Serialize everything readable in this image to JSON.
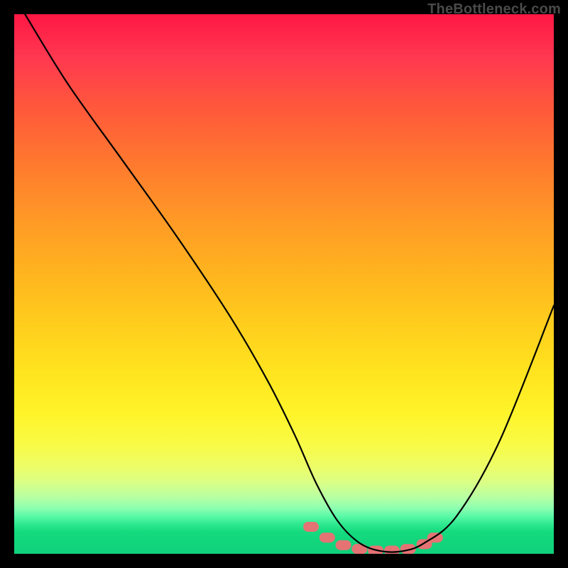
{
  "watermark": {
    "text": "TheBottleneck.com"
  },
  "chart_data": {
    "type": "line",
    "title": "",
    "xlabel": "",
    "ylabel": "",
    "xlim": [
      0,
      100
    ],
    "ylim": [
      0,
      100
    ],
    "grid": false,
    "legend": false,
    "background_gradient_stops": [
      {
        "pct": 0,
        "color": "#ff1744"
      },
      {
        "pct": 18,
        "color": "#ff5a3a"
      },
      {
        "pct": 38,
        "color": "#ff9926"
      },
      {
        "pct": 58,
        "color": "#ffcf1d"
      },
      {
        "pct": 74,
        "color": "#fff42a"
      },
      {
        "pct": 87,
        "color": "#d8ff88"
      },
      {
        "pct": 93,
        "color": "#5cf9a8"
      },
      {
        "pct": 100,
        "color": "#10d07b"
      }
    ],
    "series": [
      {
        "name": "bottleneck-curve",
        "color": "#000000",
        "x": [
          2,
          10,
          20,
          30,
          40,
          47,
          52,
          56,
          60,
          64,
          68,
          72,
          76,
          82,
          90,
          100
        ],
        "y": [
          100,
          87,
          73,
          59,
          44,
          32,
          22,
          13,
          6,
          2,
          0.5,
          0.5,
          2,
          7,
          21,
          46
        ]
      }
    ],
    "markers": {
      "name": "valley-markers",
      "color": "#e57373",
      "shape": "rounded-rect",
      "points": [
        {
          "x": 55,
          "y": 5.0
        },
        {
          "x": 58,
          "y": 3.0
        },
        {
          "x": 61,
          "y": 1.6
        },
        {
          "x": 64,
          "y": 0.9
        },
        {
          "x": 67,
          "y": 0.6
        },
        {
          "x": 70,
          "y": 0.6
        },
        {
          "x": 73,
          "y": 0.9
        },
        {
          "x": 76,
          "y": 1.8
        },
        {
          "x": 78,
          "y": 3.0
        }
      ]
    }
  }
}
